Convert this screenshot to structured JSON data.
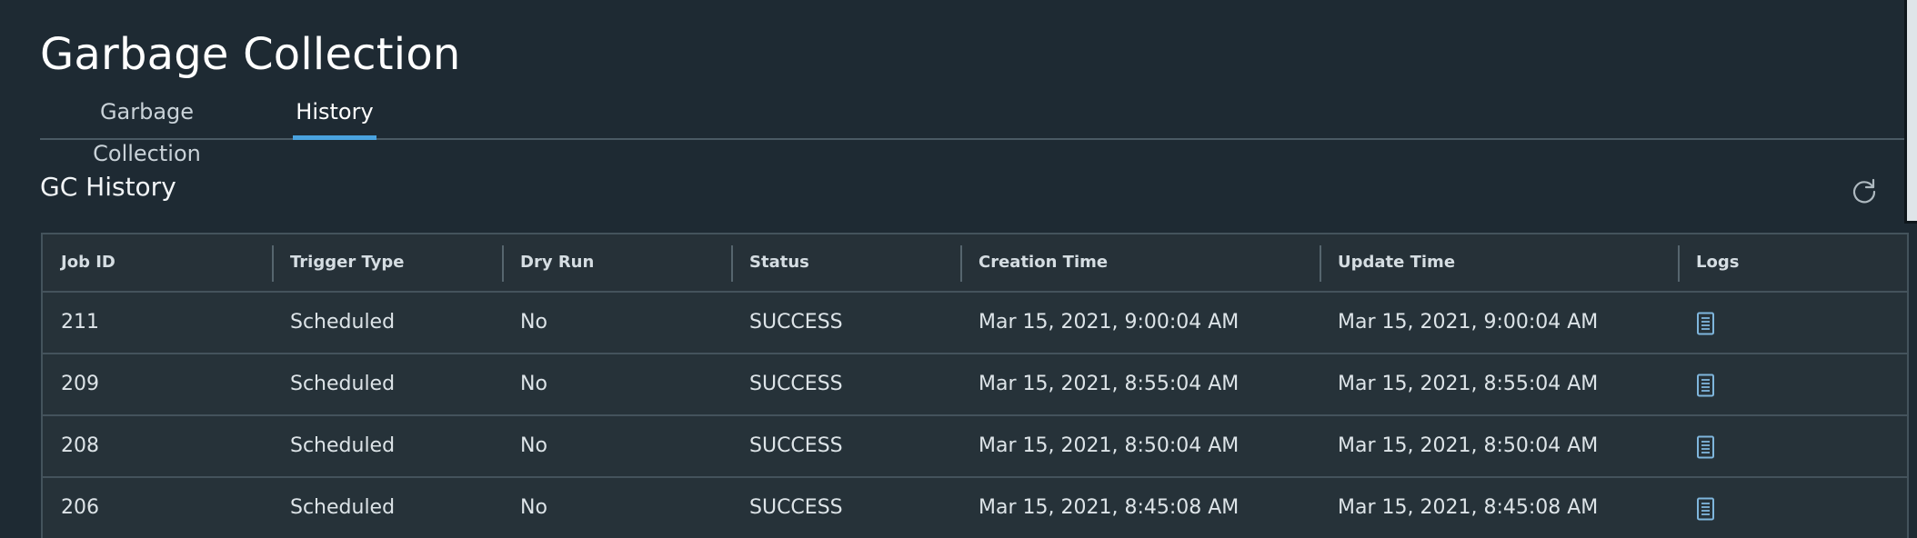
{
  "page": {
    "title": "Garbage Collection"
  },
  "tabs": [
    {
      "label": "Garbage Collection",
      "active": false
    },
    {
      "label": "History",
      "active": true
    }
  ],
  "section": {
    "title": "GC History"
  },
  "icons": {
    "refresh": "refresh-icon",
    "log": "log-document-icon"
  },
  "colors": {
    "background": "#1e2a33",
    "accent": "#4aa3df",
    "border": "#44535c",
    "icon": "#7fb6dd"
  },
  "table": {
    "columns": [
      "Job ID",
      "Trigger Type",
      "Dry Run",
      "Status",
      "Creation Time",
      "Update Time",
      "Logs"
    ],
    "rows": [
      {
        "job_id": "211",
        "trigger_type": "Scheduled",
        "dry_run": "No",
        "status": "SUCCESS",
        "creation_time": "Mar 15, 2021, 9:00:04 AM",
        "update_time": "Mar 15, 2021, 9:00:04 AM"
      },
      {
        "job_id": "209",
        "trigger_type": "Scheduled",
        "dry_run": "No",
        "status": "SUCCESS",
        "creation_time": "Mar 15, 2021, 8:55:04 AM",
        "update_time": "Mar 15, 2021, 8:55:04 AM"
      },
      {
        "job_id": "208",
        "trigger_type": "Scheduled",
        "dry_run": "No",
        "status": "SUCCESS",
        "creation_time": "Mar 15, 2021, 8:50:04 AM",
        "update_time": "Mar 15, 2021, 8:50:04 AM"
      },
      {
        "job_id": "206",
        "trigger_type": "Scheduled",
        "dry_run": "No",
        "status": "SUCCESS",
        "creation_time": "Mar 15, 2021, 8:45:08 AM",
        "update_time": "Mar 15, 2021, 8:45:08 AM"
      }
    ]
  }
}
